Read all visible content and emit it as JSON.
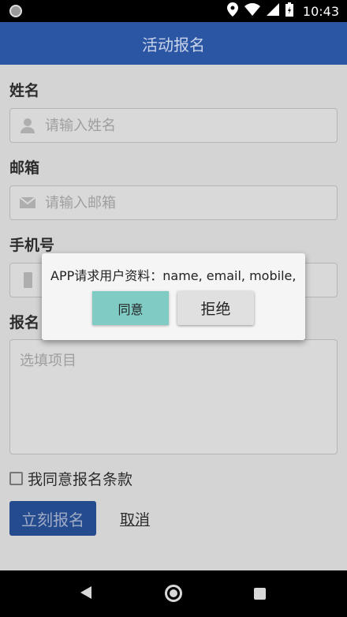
{
  "status_bar": {
    "time": "10:43",
    "icons": [
      "location-icon",
      "wifi-icon",
      "signal-icon",
      "battery-charging-icon"
    ]
  },
  "app_bar": {
    "title": "活动报名"
  },
  "form": {
    "name": {
      "label": "姓名",
      "placeholder": "请输入姓名",
      "value": ""
    },
    "email": {
      "label": "邮箱",
      "placeholder": "请输入邮箱",
      "value": ""
    },
    "phone": {
      "label": "手机号",
      "placeholder": "",
      "value": ""
    },
    "signup": {
      "label": "报名",
      "placeholder": "选填项目",
      "value": ""
    },
    "agree_label": "我同意报名条款",
    "submit_label": "立刻报名",
    "cancel_label": "取消"
  },
  "dialog": {
    "message": "APP请求用户资料：name, email, mobile,",
    "agree_label": "同意",
    "reject_label": "拒绝"
  },
  "colors": {
    "primary": "#2b56a3",
    "agree_button": "#80cbc4",
    "reject_button": "#e0e0e0"
  }
}
